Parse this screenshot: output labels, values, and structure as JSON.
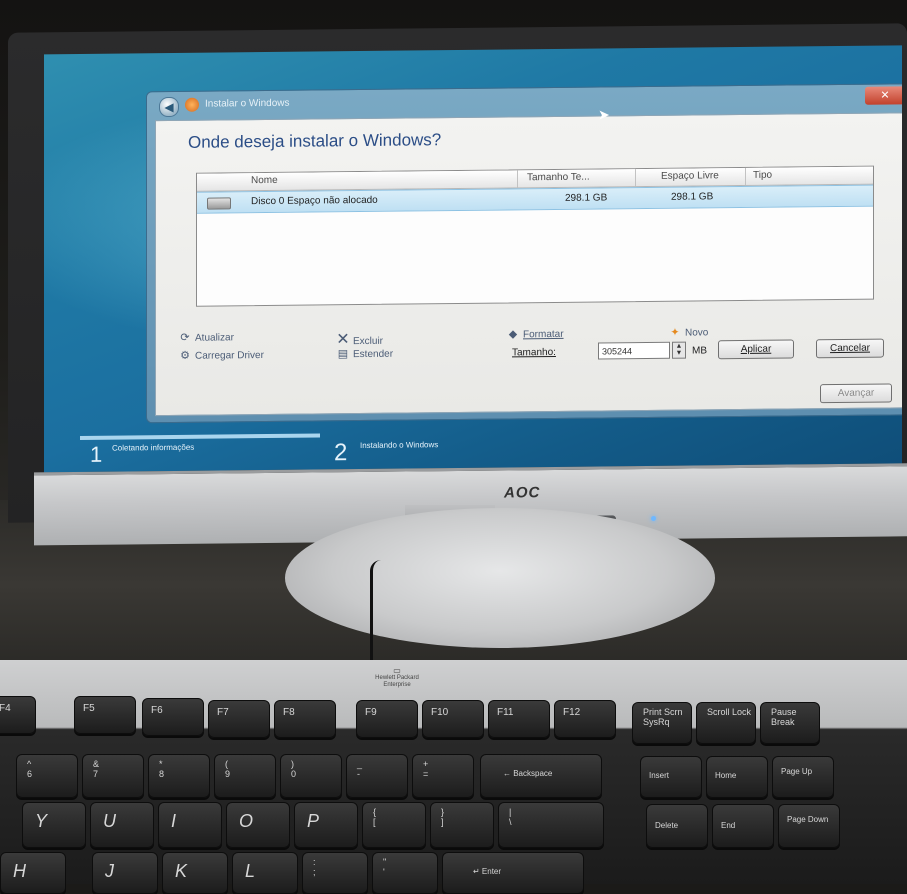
{
  "installer": {
    "title": "Instalar o Windows",
    "close_icon": "close-icon",
    "question": "Onde deseja instalar o Windows?",
    "columns": [
      "Nome",
      "Tamanho Te...",
      "Espaço Livre",
      "Tipo"
    ],
    "rows": [
      {
        "name": "Disco 0 Espaço não alocado",
        "total": "298.1 GB",
        "free": "298.1 GB",
        "type": ""
      }
    ],
    "actions": {
      "refresh": "Atualizar",
      "load_driver": "Carregar Driver",
      "delete": "Excluir",
      "extend": "Estender",
      "format": "Formatar",
      "new": "Novo"
    },
    "size_label": "Tamanho:",
    "size_value": "305244",
    "size_unit": "MB",
    "apply": "Aplicar",
    "cancel": "Cancelar",
    "next": "Avançar"
  },
  "steps": [
    {
      "num": "1",
      "label": "Coletando informações"
    },
    {
      "num": "2",
      "label": "Instalando o Windows"
    }
  ],
  "monitor": {
    "brand": "AOC"
  },
  "keyboard": {
    "brand": "Hewlett Packard",
    "brand_sub": "Enterprise",
    "fkeys": [
      "F4",
      "F5",
      "F6",
      "F7",
      "F8",
      "F9",
      "F10",
      "F11",
      "F12"
    ],
    "system_keys": [
      "Print Scrn SysRq",
      "Scroll Lock",
      "Pause Break"
    ],
    "number_row": [
      {
        "top": "^",
        "bottom": "6"
      },
      {
        "top": "&",
        "bottom": "7"
      },
      {
        "top": "*",
        "bottom": "8"
      },
      {
        "top": "(",
        "bottom": "9"
      },
      {
        "top": ")",
        "bottom": "0"
      },
      {
        "top": "_",
        "bottom": "-"
      },
      {
        "top": "+",
        "bottom": "="
      }
    ],
    "backspace": "← Backspace",
    "nav_top": [
      "Insert",
      "Home",
      "Page Up"
    ],
    "nav_bottom": [
      "Delete",
      "End",
      "Page Down"
    ],
    "letters_row": [
      "Y",
      "U",
      "I",
      "O",
      "P"
    ],
    "bracket_keys": [
      {
        "top": "{",
        "bottom": "["
      },
      {
        "top": "}",
        "bottom": "]"
      },
      {
        "top": "|",
        "bottom": "\\"
      }
    ],
    "home_row": [
      "H",
      "J",
      "K",
      "L"
    ],
    "home_punct": [
      {
        "top": ":",
        "bottom": ";"
      },
      {
        "top": "\"",
        "bottom": "'"
      }
    ],
    "enter": "↵ Enter"
  },
  "colors": {
    "screen_blue": "#1f79a5",
    "question_text": "#2b4d86",
    "selected_row": "#bfe0f3"
  }
}
